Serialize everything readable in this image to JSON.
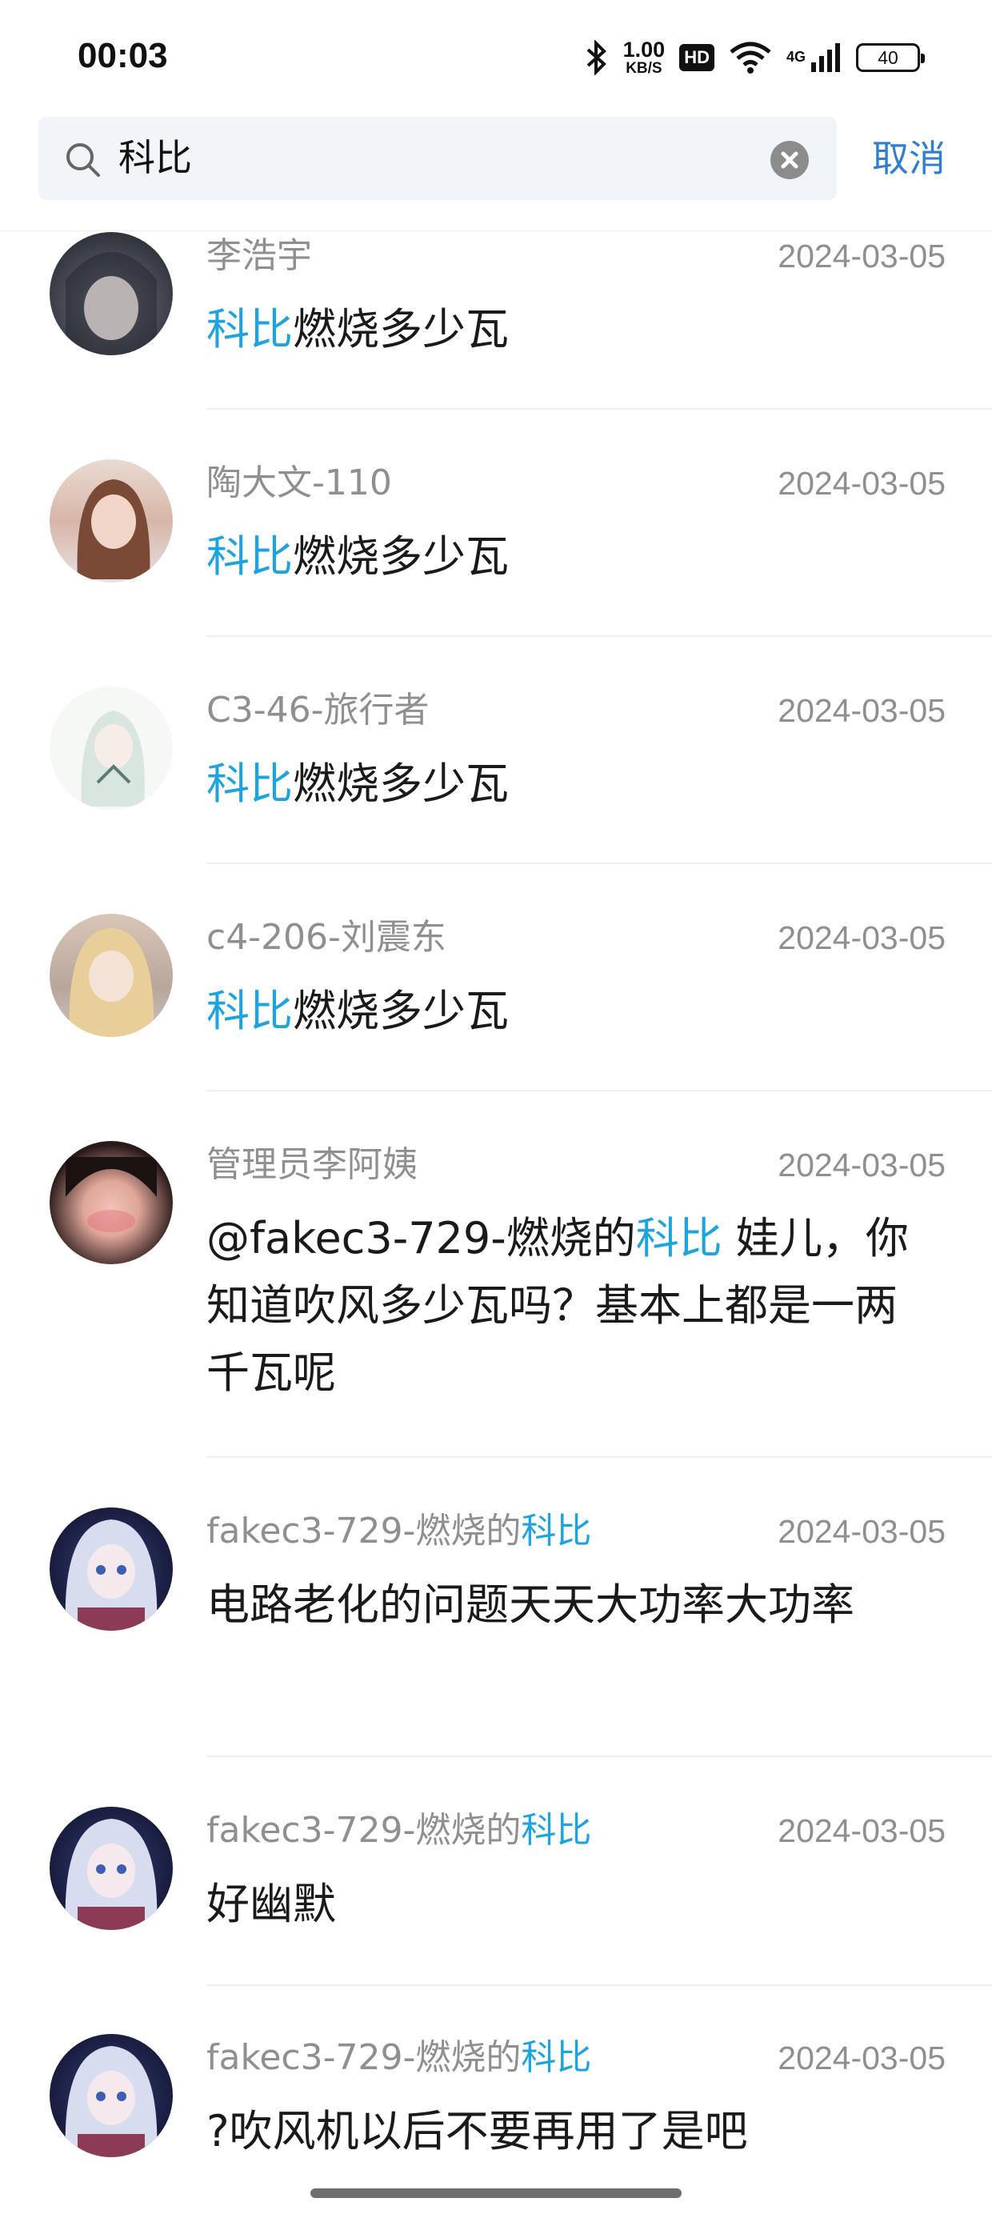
{
  "status_bar": {
    "time": "00:03",
    "net_speed_value": "1.00",
    "net_speed_unit": "KB/S",
    "hd_badge": "HD",
    "network_type": "4G",
    "battery": "40"
  },
  "search": {
    "query": "科比",
    "cancel_label": "取消"
  },
  "colors": {
    "highlight": "#1ea3df",
    "accent": "#2f7ecf",
    "meta": "#8f8f8f"
  },
  "results": [
    {
      "user": "李浩宇",
      "date": "2024-03-05",
      "msg_hl": "科比",
      "msg_rest": "燃烧多少瓦",
      "avatar": "dark-hair-anime-girl"
    },
    {
      "user": "陶大文-110",
      "date": "2024-03-05",
      "msg_hl": "科比",
      "msg_rest": "燃烧多少瓦",
      "avatar": "brown-hair-girl-waving"
    },
    {
      "user": "C3-46-旅行者",
      "date": "2024-03-05",
      "msg_hl": "科比",
      "msg_rest": "燃烧多少瓦",
      "avatar": "pale-anime-girl"
    },
    {
      "user": "c4-206-刘震东",
      "date": "2024-03-05",
      "msg_hl": "科比",
      "msg_rest": "燃烧多少瓦",
      "avatar": "blonde-anime-girl"
    },
    {
      "user": "管理员李阿姨",
      "date": "2024-03-05",
      "msg_prefix": "@fakec3-729-燃烧的",
      "msg_hl": "科比",
      "msg_rest": "  娃儿，你知道吹风多少瓦吗？基本上都是一两千瓦呢",
      "avatar": "woman-selfie"
    },
    {
      "user_prefix": "fakec3-729-燃烧的",
      "user_hl": "科比",
      "date": "2024-03-05",
      "msg": "电路老化的问题天天大功率大功率",
      "avatar": "silver-hair-anime-girl"
    },
    {
      "user_prefix": "fakec3-729-燃烧的",
      "user_hl": "科比",
      "date": "2024-03-05",
      "msg": "好幽默",
      "avatar": "silver-hair-anime-girl"
    },
    {
      "user_prefix": "fakec3-729-燃烧的",
      "user_hl": "科比",
      "date": "2024-03-05",
      "msg": "?吹风机以后不要再用了是吧",
      "avatar": "silver-hair-anime-girl"
    }
  ]
}
